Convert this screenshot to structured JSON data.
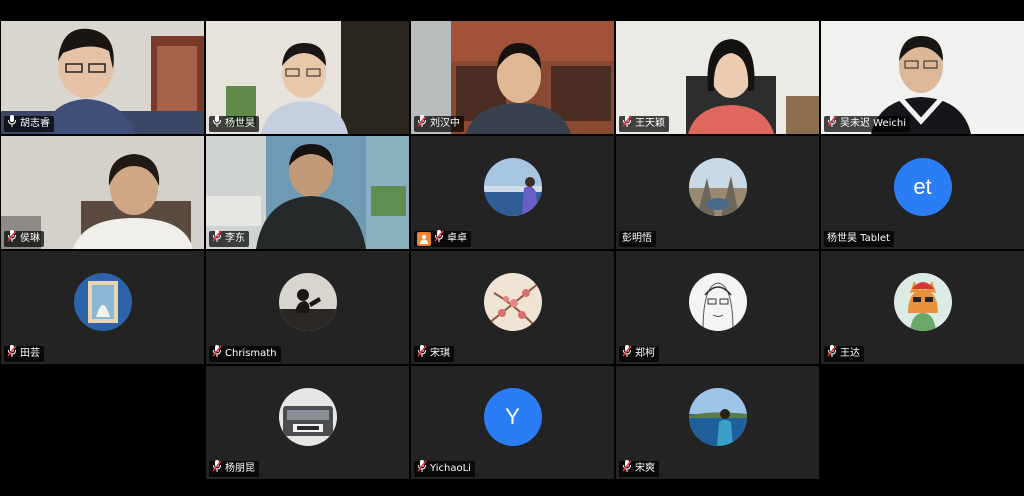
{
  "participants": [
    {
      "name": "胡志睿",
      "mic": "on",
      "view": "video"
    },
    {
      "name": "杨世昊",
      "mic": "on",
      "view": "video"
    },
    {
      "name": "刘汉中",
      "mic": "muted",
      "view": "video"
    },
    {
      "name": "王天颖",
      "mic": "muted",
      "view": "video"
    },
    {
      "name": "吴未迟 Weichi",
      "mic": "muted",
      "view": "video"
    },
    {
      "name": "侯琳",
      "mic": "muted",
      "view": "video"
    },
    {
      "name": "李东",
      "mic": "muted",
      "view": "video"
    },
    {
      "name": "卓卓",
      "mic": "muted",
      "view": "avatar",
      "badge": "person-icon"
    },
    {
      "name": "彭明悟",
      "mic": "none",
      "view": "avatar"
    },
    {
      "name": "杨世昊 Tablet",
      "mic": "none",
      "view": "avatar-letter",
      "initials": "et",
      "avatar_color": "#2b7df5"
    },
    {
      "name": "田芸",
      "mic": "muted",
      "view": "avatar"
    },
    {
      "name": "Chrismath",
      "mic": "muted",
      "view": "avatar"
    },
    {
      "name": "宋琪",
      "mic": "muted",
      "view": "avatar"
    },
    {
      "name": "郑柯",
      "mic": "muted",
      "view": "avatar"
    },
    {
      "name": "王达",
      "mic": "muted",
      "view": "avatar"
    },
    {
      "name": "杨朋昆",
      "mic": "muted",
      "view": "avatar"
    },
    {
      "name": "YichaoLi",
      "mic": "muted",
      "view": "avatar-letter",
      "initials": "Y",
      "avatar_color": "#2b7df5"
    },
    {
      "name": "宋爽",
      "mic": "muted",
      "view": "avatar"
    }
  ],
  "colors": {
    "tile_bg": "#232323",
    "muted_mic": "#e8323c",
    "letter_avatar": "#2b7df5",
    "background": "#000000"
  }
}
